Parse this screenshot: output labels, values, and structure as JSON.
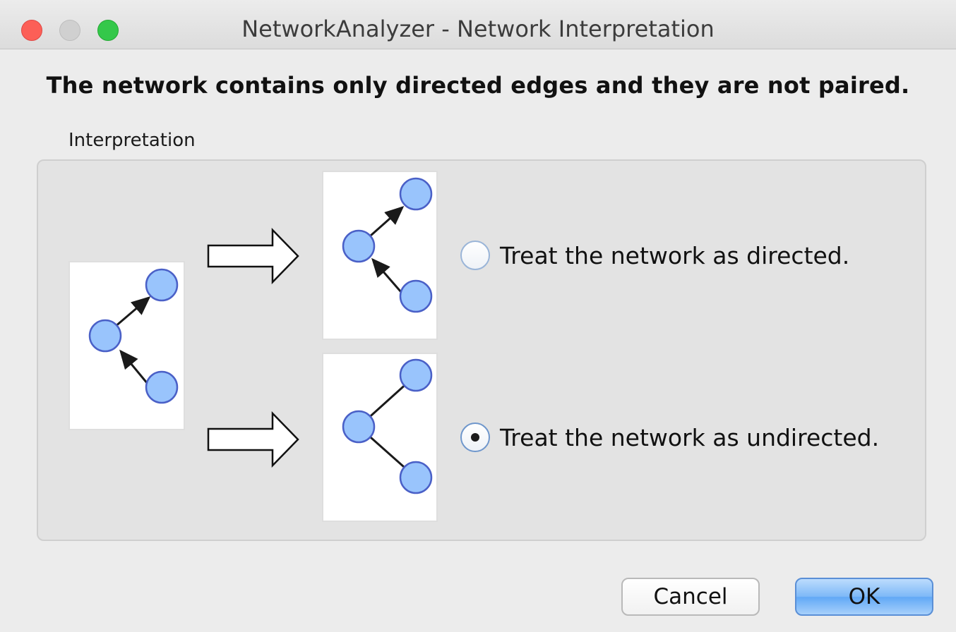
{
  "window": {
    "title": "NetworkAnalyzer - Network Interpretation",
    "controls": [
      "close-icon",
      "minimize-icon",
      "zoom-icon"
    ],
    "control_colors": {
      "close": "#fc5f57",
      "minimize": "#d0d0d0",
      "zoom": "#34c84a"
    }
  },
  "message": "The network contains only directed edges and they are not paired.",
  "group": {
    "label": "Interpretation",
    "source_graph": "directed-graph-icon",
    "options": [
      {
        "label": "Treat the network as directed.",
        "graph": "directed-graph-icon",
        "selected": false
      },
      {
        "label": "Treat the network as undirected.",
        "graph": "undirected-graph-icon",
        "selected": true
      }
    ]
  },
  "buttons": {
    "cancel": "Cancel",
    "ok": "OK"
  },
  "colors": {
    "node_fill": "#99c4fc",
    "node_stroke": "#4a60c7",
    "default_button": "#7db8f7"
  }
}
